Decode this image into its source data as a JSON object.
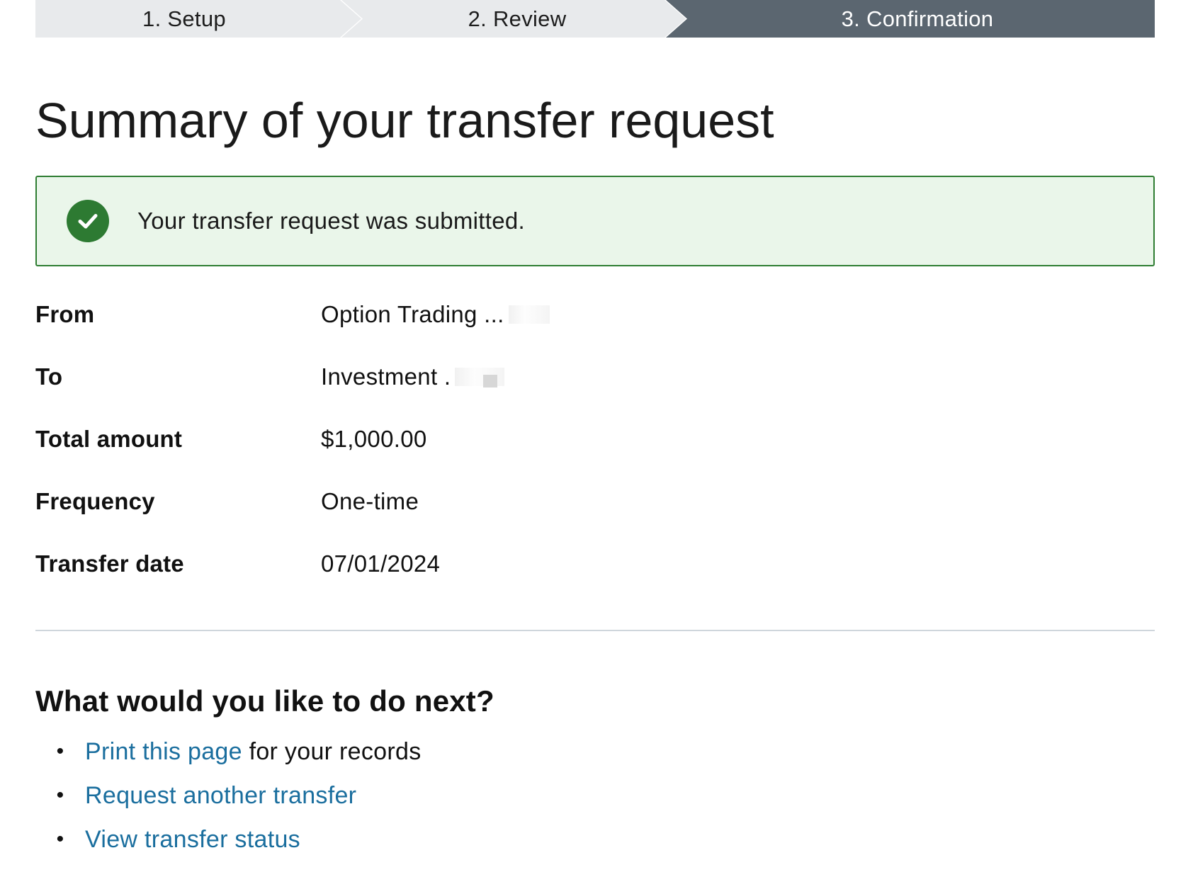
{
  "stepper": {
    "steps": [
      {
        "label": "1. Setup",
        "state": "inactive"
      },
      {
        "label": "2. Review",
        "state": "inactive"
      },
      {
        "label": "3. Confirmation",
        "state": "active"
      }
    ]
  },
  "page_title": "Summary of your transfer request",
  "banner": {
    "icon": "check-circle-icon",
    "message": "Your transfer request was submitted.",
    "color": "#2e7d32",
    "background": "#eaf6ea"
  },
  "details": [
    {
      "label": "From",
      "value": "Option Trading ..."
    },
    {
      "label": "To",
      "value": "Investment ."
    },
    {
      "label": "Total amount",
      "value": "$1,000.00"
    },
    {
      "label": "Frequency",
      "value": "One-time"
    },
    {
      "label": "Transfer date",
      "value": "07/01/2024"
    }
  ],
  "next_steps": {
    "heading": "What would you like to do next?",
    "items": [
      {
        "link_text": "Print this page",
        "after_text": " for your records"
      },
      {
        "link_text": "Request another transfer",
        "after_text": ""
      },
      {
        "link_text": "View transfer status",
        "after_text": ""
      }
    ]
  },
  "colors": {
    "link": "#1a6e9e",
    "active_step": "#5b6670",
    "inactive_step": "#e8eaec"
  }
}
